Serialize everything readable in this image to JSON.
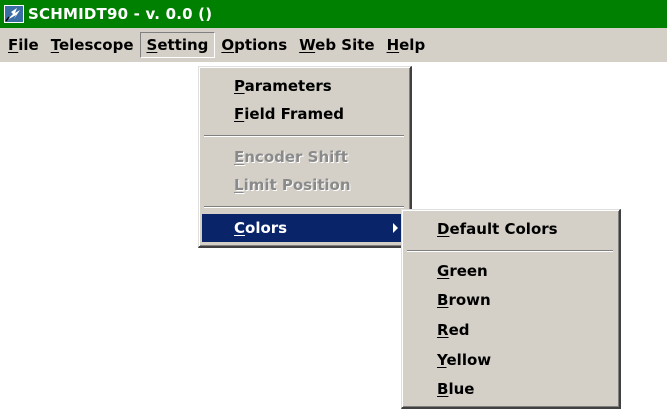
{
  "window": {
    "title": "SCHMIDT90 - v. 0.0  ()",
    "icon": "app-logo-icon"
  },
  "menubar": {
    "file": "File",
    "telescope": "Telescope",
    "setting": "Setting",
    "options": "Options",
    "website": "Web Site",
    "help": "Help"
  },
  "setting_menu": {
    "parameters": "Parameters",
    "field_framed": "Field Framed",
    "encoder_shift": "Encoder Shift",
    "limit_position": "Limit Position",
    "colors": "Colors"
  },
  "colors_menu": {
    "default_colors": "Default Colors",
    "green": "Green",
    "brown": "Brown",
    "red": "Red",
    "yellow": "Yellow",
    "blue": "Blue"
  },
  "colors": {
    "titlebar": "#008000",
    "menu_bg": "#d4d0c8",
    "highlight": "#0a246a",
    "disabled_text": "#8a8a8a"
  }
}
